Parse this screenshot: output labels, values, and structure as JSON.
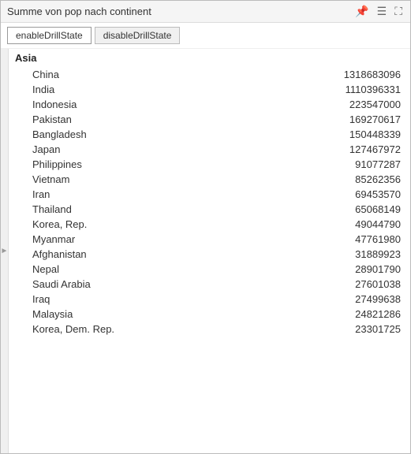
{
  "window": {
    "title": "Summe von pop nach continent",
    "icons": {
      "pin": "📌",
      "menu": "≡",
      "expand": "⛶"
    }
  },
  "toolbar": {
    "enable_label": "enableDrillState",
    "disable_label": "disableDrillState"
  },
  "group": {
    "name": "Asia",
    "rows": [
      {
        "country": "China",
        "value": "1318683096"
      },
      {
        "country": "India",
        "value": "1110396331"
      },
      {
        "country": "Indonesia",
        "value": "223547000"
      },
      {
        "country": "Pakistan",
        "value": "169270617"
      },
      {
        "country": "Bangladesh",
        "value": "150448339"
      },
      {
        "country": "Japan",
        "value": "127467972"
      },
      {
        "country": "Philippines",
        "value": "91077287"
      },
      {
        "country": "Vietnam",
        "value": "85262356"
      },
      {
        "country": "Iran",
        "value": "69453570"
      },
      {
        "country": "Thailand",
        "value": "65068149"
      },
      {
        "country": "Korea, Rep.",
        "value": "49044790"
      },
      {
        "country": "Myanmar",
        "value": "47761980"
      },
      {
        "country": "Afghanistan",
        "value": "31889923"
      },
      {
        "country": "Nepal",
        "value": "28901790"
      },
      {
        "country": "Saudi Arabia",
        "value": "27601038"
      },
      {
        "country": "Iraq",
        "value": "27499638"
      },
      {
        "country": "Malaysia",
        "value": "24821286"
      },
      {
        "country": "Korea, Dem. Rep.",
        "value": "23301725"
      }
    ]
  }
}
